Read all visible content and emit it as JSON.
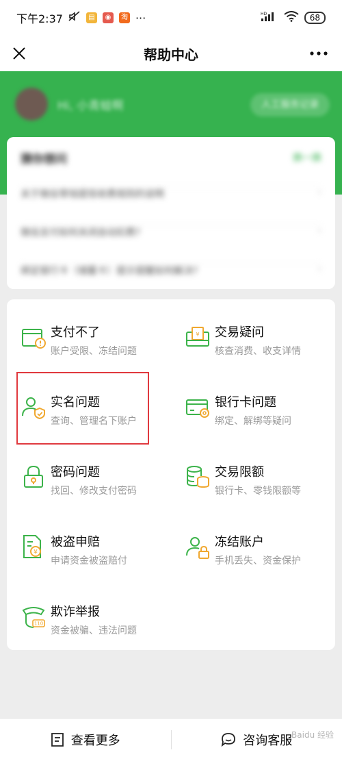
{
  "status_bar": {
    "time": "下午2:37",
    "dots": "···",
    "signal": "HD",
    "battery": "68"
  },
  "nav": {
    "title": "帮助中心"
  },
  "header": {
    "greeting": "Hi, 小青蛙啊",
    "action_button": "人工服务记录"
  },
  "faq": {
    "title": "猜你想问",
    "refresh": "换一换",
    "items": [
      "关于微信零钱提现收费规则的说明",
      "微信支付如何关闭自动扣费?",
      "绑定银行卡（储蓄卡）提示提醒如何解决?"
    ]
  },
  "categories": [
    {
      "title": "支付不了",
      "subtitle": "账户受限、冻结问题",
      "icon": "wallet-alert-icon"
    },
    {
      "title": "交易疑问",
      "subtitle": "核查消费、收支详情",
      "icon": "receipt-icon"
    },
    {
      "title": "实名问题",
      "subtitle": "查询、管理名下账户",
      "icon": "user-shield-icon"
    },
    {
      "title": "银行卡问题",
      "subtitle": "绑定、解绑等疑问",
      "icon": "bank-card-icon"
    },
    {
      "title": "密码问题",
      "subtitle": "找回、修改支付密码",
      "icon": "lock-icon"
    },
    {
      "title": "交易限额",
      "subtitle": "银行卡、零钱限额等",
      "icon": "coins-icon"
    },
    {
      "title": "被盗申赔",
      "subtitle": "申请资金被盗赔付",
      "icon": "document-claim-icon"
    },
    {
      "title": "冻结账户",
      "subtitle": "手机丢失、资金保护",
      "icon": "user-lock-icon"
    },
    {
      "title": "欺诈举报",
      "subtitle": "资金被骗、违法问题",
      "icon": "police-report-icon"
    }
  ],
  "bottom": {
    "more": "查看更多",
    "service": "咨询客服"
  },
  "watermark": "Baidu 经验",
  "colors": {
    "brand_green": "#36b24f",
    "icon_green": "#3cb34a",
    "icon_orange": "#f0a830",
    "highlight_red": "#e0393e"
  }
}
